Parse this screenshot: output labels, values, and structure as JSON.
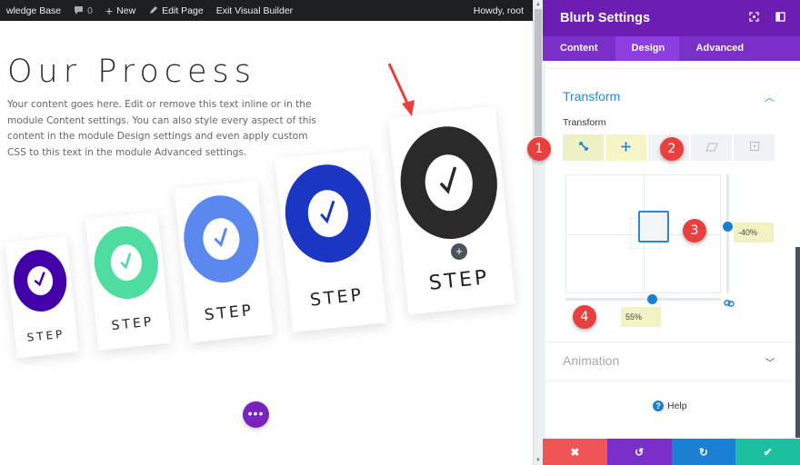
{
  "adminbar": {
    "site": "wledge Base",
    "comments_count": "0",
    "new_label": "New",
    "edit_page_label": "Edit Page",
    "exit_builder_label": "Exit Visual Builder",
    "greeting": "Howdy, root"
  },
  "page": {
    "title": "Our Process",
    "body": "Your content goes here. Edit or remove this text inline or in the module Content settings. You can also style every aspect of this content in the module Design settings and even apply custom CSS to this text in the module Advanced settings.",
    "cards": [
      {
        "label": "STEP",
        "color": "#4400a8"
      },
      {
        "label": "STEP",
        "color": "#4fdca0"
      },
      {
        "label": "STEP",
        "color": "#5a88ef"
      },
      {
        "label": "STEP",
        "color": "#1a36c2"
      },
      {
        "label": "STEP",
        "color": "#2a2a2a"
      }
    ],
    "add_module_symbol": "+",
    "more_symbol": "•••"
  },
  "panel": {
    "title": "Blurb Settings",
    "tabs": [
      {
        "label": "Content"
      },
      {
        "label": "Design",
        "active": true
      },
      {
        "label": "Advanced"
      }
    ],
    "transform_section": "Transform",
    "transform_label": "Transform",
    "transform_buttons": [
      "scale",
      "translate",
      "rotate",
      "skew",
      "origin"
    ],
    "translate_y": "-40%",
    "translate_x": "55%",
    "translate_x_value": 0.55,
    "translate_y_value": -0.4,
    "animation_section": "Animation",
    "help_label": "Help",
    "footer": {
      "cancel_color": "#ef5555",
      "undo_color": "#7b2fc9",
      "redo_color": "#1b7fd4",
      "save_color": "#1cc0a0"
    }
  },
  "callouts": [
    "1",
    "2",
    "3",
    "4"
  ],
  "colors": {
    "accent": "#2b87da",
    "panel_header": "#6c1db2",
    "callout": "#e8403f"
  }
}
